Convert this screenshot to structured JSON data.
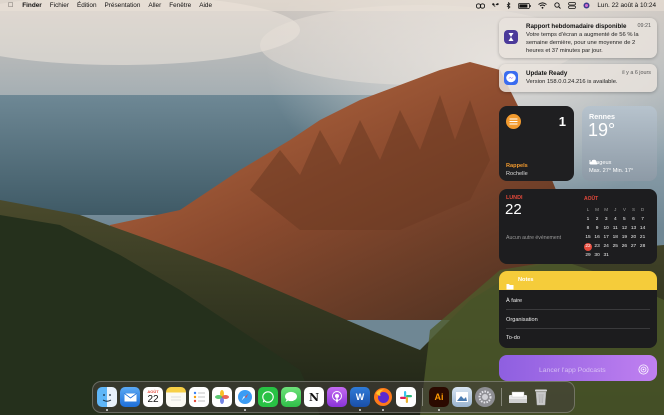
{
  "menubar": {
    "app_name": "Finder",
    "items": [
      "Fichier",
      "Édition",
      "Présentation",
      "Aller",
      "Fenêtre",
      "Aide"
    ],
    "clock": "Lun. 22 août à 10:24"
  },
  "notifications": [
    {
      "title": "Rapport hebdomadaire disponible",
      "time": "09:21",
      "body": "Votre temps d'écran a augmenté de 56 % la semaine dernière, pour une moyenne de 2 heures et 37 minutes par jour.",
      "icon": "screen-time-icon",
      "icon_color": "#4b3a9a"
    },
    {
      "title": "Update Ready",
      "time": "il y a 6 jours",
      "body": "Version 158.0.0.24.216 is available.",
      "icon": "messenger-icon",
      "icon_color": "#3a6cf0"
    }
  ],
  "reminders_widget": {
    "count": "1",
    "title": "Rappels",
    "subtitle": "Rochelle",
    "accent": "#f29a2e"
  },
  "weather_widget": {
    "city": "Rennes",
    "temperature": "19°",
    "condition": "Nuageux",
    "range": "Max. 27° Min. 17°"
  },
  "calendar_widget": {
    "weekday": "LUNDI",
    "day": "22",
    "no_events": "Aucun autre événement",
    "month": "AOÛT",
    "weekday_headers": [
      "L",
      "M",
      "M",
      "J",
      "V",
      "S",
      "D"
    ],
    "weeks": [
      [
        "1",
        "2",
        "3",
        "4",
        "5",
        "6",
        "7"
      ],
      [
        "8",
        "9",
        "10",
        "11",
        "12",
        "13",
        "14"
      ],
      [
        "15",
        "16",
        "17",
        "18",
        "19",
        "20",
        "21"
      ],
      [
        "22",
        "23",
        "24",
        "25",
        "26",
        "27",
        "28"
      ],
      [
        "29",
        "30",
        "31",
        "",
        "",
        "",
        ""
      ]
    ],
    "today": "22",
    "accent": "#e5493b"
  },
  "notes_widget": {
    "title": "Notes",
    "items": [
      "À faire",
      "Organisation",
      "To-do"
    ],
    "accent": "#f5cc3a"
  },
  "shortcut_widget": {
    "label": "Lancer l'app Podcasts"
  },
  "dock": {
    "calendar_month": "AOÛT",
    "calendar_day": "22",
    "apps": [
      "finder-icon",
      "mail-icon",
      "calendar-icon",
      "notes-icon",
      "reminders-icon",
      "photos-icon",
      "safari-icon",
      "whatsapp-icon",
      "messages-icon",
      "notion-icon",
      "podcasts-icon",
      "word-icon",
      "firefox-icon",
      "slack-icon",
      "illustrator-icon",
      "preview-icon",
      "system-preferences-icon",
      "downloads-icon",
      "trash-icon"
    ]
  }
}
